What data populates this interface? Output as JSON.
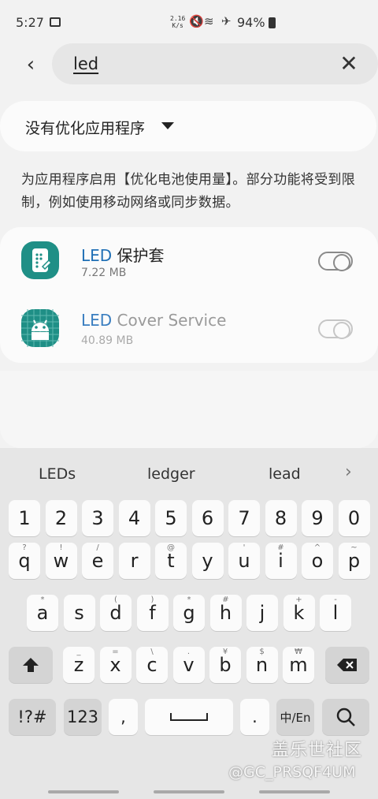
{
  "status_bar": {
    "time": "5:27",
    "net_speed_value": "2.16",
    "net_speed_unit": "K/s",
    "battery": "94%"
  },
  "search": {
    "query": "led",
    "back_icon": "‹",
    "clear_icon": "✕"
  },
  "filter": {
    "label": "没有优化应用程序"
  },
  "description": "为应用程序启用【优化电池使用量】。部分功能将受到限制，例如使用移动网络或同步数据。",
  "apps": [
    {
      "name_highlight": "LED",
      "name_rest": " 保护套",
      "size": "7.22 MB",
      "enabled": false
    },
    {
      "name_highlight": "LED",
      "name_rest": " Cover Service",
      "size": "40.89 MB",
      "enabled": false
    }
  ],
  "keyboard": {
    "suggestions": [
      "LEDs",
      "ledger",
      "lead"
    ],
    "numbers": [
      "1",
      "2",
      "3",
      "4",
      "5",
      "6",
      "7",
      "8",
      "9",
      "0"
    ],
    "row1": [
      [
        "q",
        "?"
      ],
      [
        "w",
        "!"
      ],
      [
        "e",
        "/"
      ],
      [
        "r",
        ""
      ],
      [
        "t",
        "@"
      ],
      [
        "y",
        ""
      ],
      [
        "u",
        "'"
      ],
      [
        "i",
        "#"
      ],
      [
        "o",
        "^"
      ],
      [
        "p",
        "~"
      ]
    ],
    "row2": [
      [
        "a",
        "*"
      ],
      [
        "s",
        ""
      ],
      [
        "d",
        "("
      ],
      [
        "f",
        ")"
      ],
      [
        "g",
        "*"
      ],
      [
        "h",
        "#"
      ],
      [
        "j",
        ""
      ],
      [
        "k",
        "+"
      ],
      [
        "l",
        "-"
      ]
    ],
    "row3": [
      [
        "z",
        "_"
      ],
      [
        "x",
        "="
      ],
      [
        "c",
        "\\"
      ],
      [
        "v",
        "."
      ],
      [
        "b",
        "¥"
      ],
      [
        "n",
        "$"
      ],
      [
        "m",
        "₩"
      ]
    ],
    "symbols_label": "!?#",
    "numeric_label": "123",
    "comma_label": ",",
    "period_label": ".",
    "lang_label": "中/En"
  },
  "watermark": {
    "line1": "盖乐世社区",
    "line2": "@GC_PRSQF4UM"
  }
}
